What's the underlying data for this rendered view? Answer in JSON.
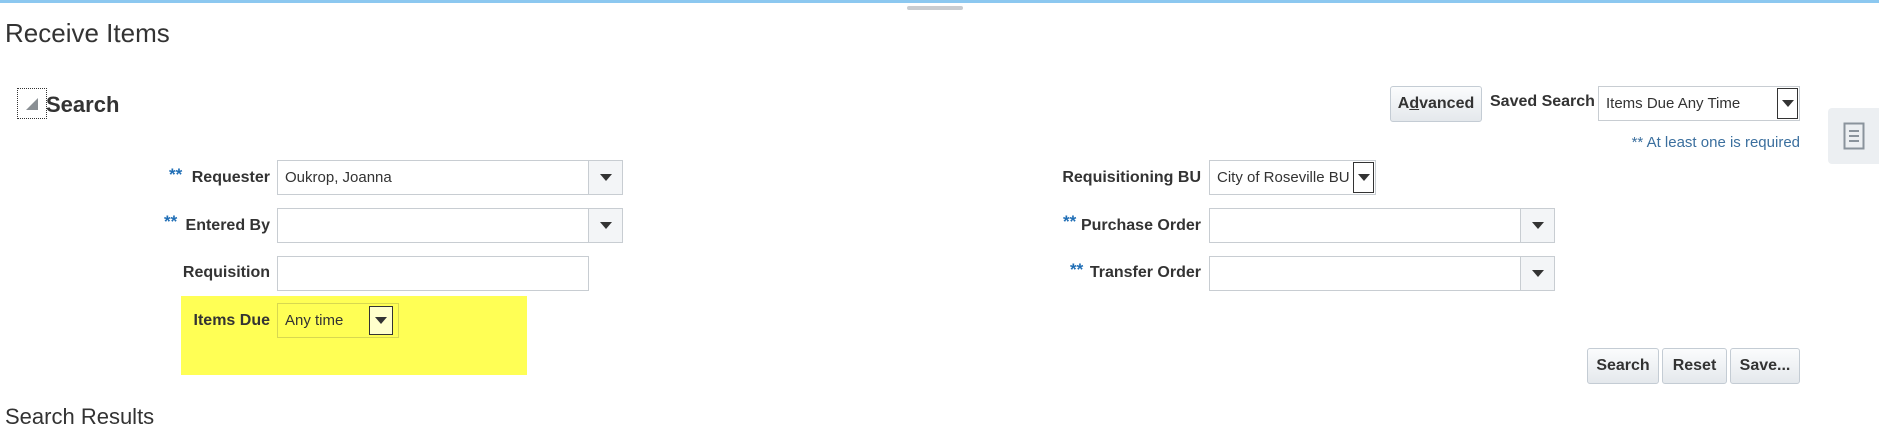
{
  "page": {
    "title": "Receive Items"
  },
  "search": {
    "section_title": "Search",
    "advanced_label": "Advanced",
    "advanced_mnemonic": "d",
    "saved_search_label": "Saved Search",
    "saved_search_value": "Items Due Any Time",
    "required_note": "** At least one is required",
    "required_marker": "**",
    "fields": {
      "requester": {
        "label": "Requester",
        "value": "Oukrop, Joanna"
      },
      "entered_by": {
        "label": "Entered By",
        "value": ""
      },
      "requisition": {
        "label": "Requisition",
        "value": ""
      },
      "items_due": {
        "label": "Items Due",
        "value": "Any time"
      },
      "requisitioning_bu": {
        "label": "Requisitioning BU",
        "value": "City of Roseville BU"
      },
      "purchase_order": {
        "label": "Purchase Order",
        "value": ""
      },
      "transfer_order": {
        "label": "Transfer Order",
        "value": ""
      }
    },
    "buttons": {
      "search": "Search",
      "reset": "Reset",
      "save": "Save..."
    }
  },
  "results": {
    "title": "Search Results"
  },
  "colors": {
    "highlight": "#ffff55",
    "required": "#1e6db5",
    "top_border": "#8cc8f0"
  },
  "icons": {
    "disclosure": "triangle-expanded-icon",
    "side_panel": "document-list-icon",
    "dropdown": "chevron-down-icon"
  }
}
